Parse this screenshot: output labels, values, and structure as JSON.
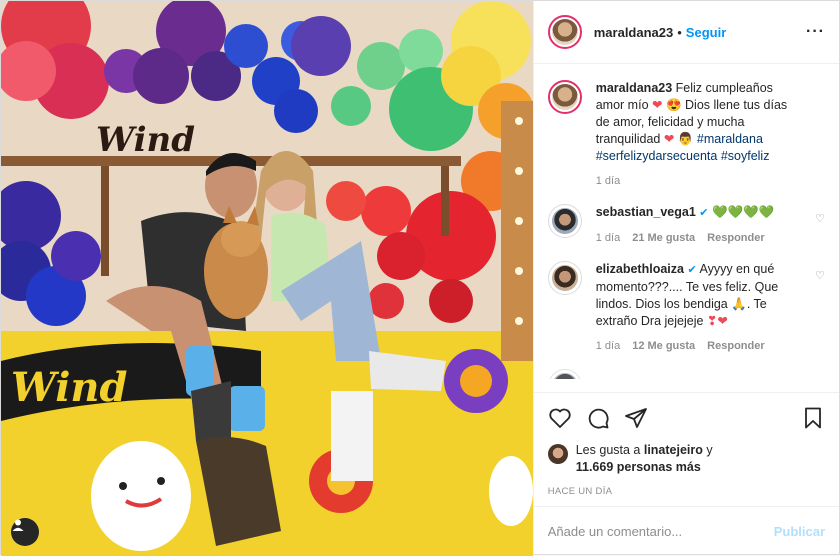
{
  "colors": {
    "accent": "#0095f6",
    "muted": "#8e8e8e",
    "text": "#262626",
    "heart_red": "#ed4956",
    "publish_disabled": "#b2dffc"
  },
  "post": {
    "photo_text": "Wind",
    "author": "maraldana23",
    "separator": "•",
    "follow_label": "Seguir",
    "more_label": "···"
  },
  "caption": {
    "user": "maraldana23",
    "text_1": " Feliz cumpleaños amor mío ",
    "text_2": " Dios llene tus días de amor, felicidad y mucha tranquilidad ",
    "hashtags": [
      "#maraldana",
      "#serfelizydarsecuenta",
      "#soyfeliz"
    ],
    "time": "1 día"
  },
  "comments": [
    {
      "user": "sebastian_vega1",
      "text": "",
      "time": "1 día",
      "likes": "21 Me gusta",
      "reply": "Responder",
      "heart_icon": "heart-outline-icon"
    },
    {
      "user": "elizabethloaiza",
      "text": " Ayyyy en qué momento???.... Te ves feliz. Que lindos. Dios los bendiga ",
      "text_2": ". Te extraño Dra jejejeje ",
      "time": "1 día",
      "likes": "12 Me gusta",
      "reply": "Responder",
      "heart_icon": "heart-outline-icon"
    }
  ],
  "actions": {
    "icons": [
      "heart-icon",
      "comment-icon",
      "share-icon",
      "bookmark-icon"
    ]
  },
  "likes": {
    "prefix": "Les gusta a ",
    "user": "linatejeiro",
    "middle": " y",
    "count": "11.669 personas más"
  },
  "timestamp": "HACE UN DÍA",
  "add_comment": {
    "placeholder": "Añade un comentario...",
    "publish_label": "Publicar"
  }
}
